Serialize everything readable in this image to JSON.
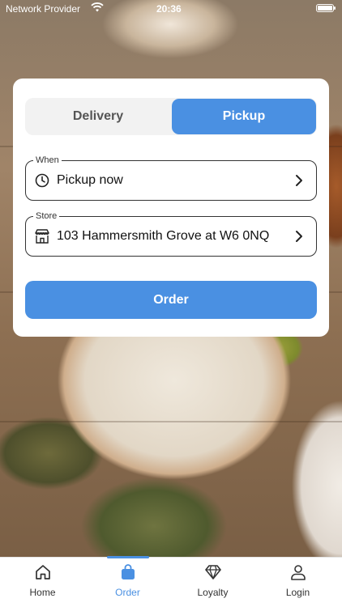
{
  "status_bar": {
    "carrier": "Network Provider",
    "time": "20:36"
  },
  "order_card": {
    "mode_options": [
      {
        "label": "Delivery",
        "selected": false
      },
      {
        "label": "Pickup",
        "selected": true
      }
    ],
    "when": {
      "legend": "When",
      "value": "Pickup now",
      "icon": "clock-icon"
    },
    "store": {
      "legend": "Store",
      "value": "103 Hammersmith Grove at W6 0NQ",
      "icon": "store-icon"
    },
    "order_button": "Order"
  },
  "tab_bar": {
    "tabs": [
      {
        "label": "Home",
        "icon": "home-icon",
        "active": false
      },
      {
        "label": "Order",
        "icon": "shopping-bag-icon",
        "active": true
      },
      {
        "label": "Loyalty",
        "icon": "diamond-icon",
        "active": false
      },
      {
        "label": "Login",
        "icon": "person-icon",
        "active": false
      }
    ]
  },
  "colors": {
    "accent": "#4a90e2",
    "segment_bg": "#f2f2f2",
    "card_bg": "#ffffff"
  }
}
